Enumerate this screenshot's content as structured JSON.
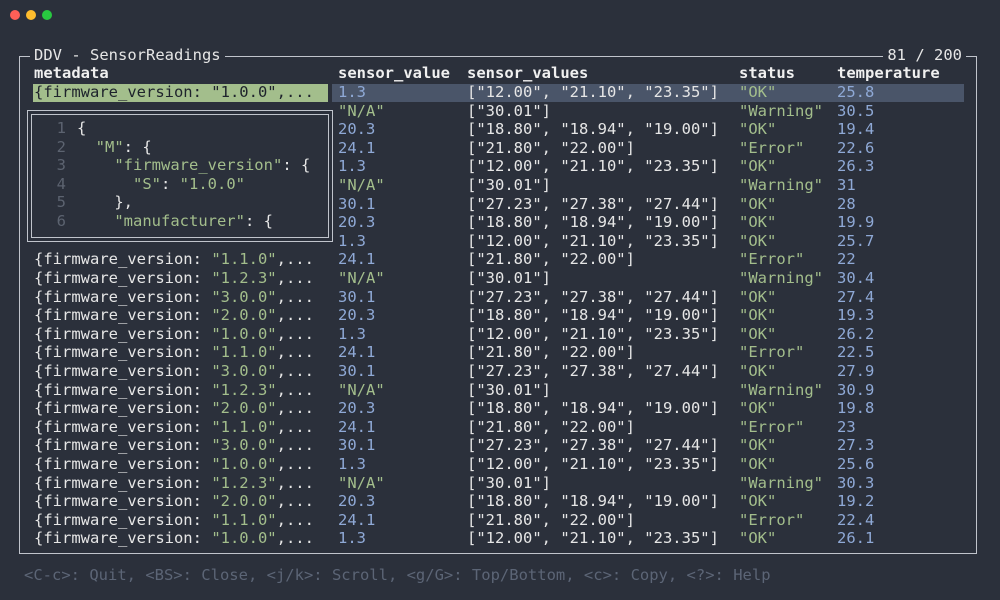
{
  "window": {
    "title": "DDV - SensorReadings",
    "position": "81 / 200"
  },
  "columns": [
    "metadata",
    "sensor_value",
    "sensor_values",
    "status",
    "temperature"
  ],
  "selected_row": {
    "metadata": "{firmware_version: \"1.0.0\",...",
    "sensor_value": "1.3",
    "sensor_values": "[\"12.00\", \"21.10\", \"23.35\"]",
    "status": "\"OK\"",
    "temperature": "25.8"
  },
  "rows": [
    {
      "metadata": "",
      "sensor_value": "\"N/A\"",
      "sensor_values": "[\"30.01\"]",
      "status": "\"Warning\"",
      "temperature": "30.5"
    },
    {
      "metadata": "",
      "sensor_value": "20.3",
      "sensor_values": "[\"18.80\", \"18.94\", \"19.00\"]",
      "status": "\"OK\"",
      "temperature": "19.4"
    },
    {
      "metadata": "",
      "sensor_value": "24.1",
      "sensor_values": "[\"21.80\", \"22.00\"]",
      "status": "\"Error\"",
      "temperature": "22.6"
    },
    {
      "metadata": "",
      "sensor_value": "1.3",
      "sensor_values": "[\"12.00\", \"21.10\", \"23.35\"]",
      "status": "\"OK\"",
      "temperature": "26.3"
    },
    {
      "metadata": "",
      "sensor_value": "\"N/A\"",
      "sensor_values": "[\"30.01\"]",
      "status": "\"Warning\"",
      "temperature": "31"
    },
    {
      "metadata": "",
      "sensor_value": "30.1",
      "sensor_values": "[\"27.23\", \"27.38\", \"27.44\"]",
      "status": "\"OK\"",
      "temperature": "28"
    },
    {
      "metadata": "",
      "sensor_value": "20.3",
      "sensor_values": "[\"18.80\", \"18.94\", \"19.00\"]",
      "status": "\"OK\"",
      "temperature": "19.9"
    },
    {
      "metadata": "",
      "sensor_value": "1.3",
      "sensor_values": "[\"12.00\", \"21.10\", \"23.35\"]",
      "status": "\"OK\"",
      "temperature": "25.7"
    },
    {
      "metadata": "{firmware_version: \"1.1.0\",...",
      "sensor_value": "24.1",
      "sensor_values": "[\"21.80\", \"22.00\"]",
      "status": "\"Error\"",
      "temperature": "22"
    },
    {
      "metadata": "{firmware_version: \"1.2.3\",...",
      "sensor_value": "\"N/A\"",
      "sensor_values": "[\"30.01\"]",
      "status": "\"Warning\"",
      "temperature": "30.4"
    },
    {
      "metadata": "{firmware_version: \"3.0.0\",...",
      "sensor_value": "30.1",
      "sensor_values": "[\"27.23\", \"27.38\", \"27.44\"]",
      "status": "\"OK\"",
      "temperature": "27.4"
    },
    {
      "metadata": "{firmware_version: \"2.0.0\",...",
      "sensor_value": "20.3",
      "sensor_values": "[\"18.80\", \"18.94\", \"19.00\"]",
      "status": "\"OK\"",
      "temperature": "19.3"
    },
    {
      "metadata": "{firmware_version: \"1.0.0\",...",
      "sensor_value": "1.3",
      "sensor_values": "[\"12.00\", \"21.10\", \"23.35\"]",
      "status": "\"OK\"",
      "temperature": "26.2"
    },
    {
      "metadata": "{firmware_version: \"1.1.0\",...",
      "sensor_value": "24.1",
      "sensor_values": "[\"21.80\", \"22.00\"]",
      "status": "\"Error\"",
      "temperature": "22.5"
    },
    {
      "metadata": "{firmware_version: \"3.0.0\",...",
      "sensor_value": "30.1",
      "sensor_values": "[\"27.23\", \"27.38\", \"27.44\"]",
      "status": "\"OK\"",
      "temperature": "27.9"
    },
    {
      "metadata": "{firmware_version: \"1.2.3\",...",
      "sensor_value": "\"N/A\"",
      "sensor_values": "[\"30.01\"]",
      "status": "\"Warning\"",
      "temperature": "30.9"
    },
    {
      "metadata": "{firmware_version: \"2.0.0\",...",
      "sensor_value": "20.3",
      "sensor_values": "[\"18.80\", \"18.94\", \"19.00\"]",
      "status": "\"OK\"",
      "temperature": "19.8"
    },
    {
      "metadata": "{firmware_version: \"1.1.0\",...",
      "sensor_value": "24.1",
      "sensor_values": "[\"21.80\", \"22.00\"]",
      "status": "\"Error\"",
      "temperature": "23"
    },
    {
      "metadata": "{firmware_version: \"3.0.0\",...",
      "sensor_value": "30.1",
      "sensor_values": "[\"27.23\", \"27.38\", \"27.44\"]",
      "status": "\"OK\"",
      "temperature": "27.3"
    },
    {
      "metadata": "{firmware_version: \"1.0.0\",...",
      "sensor_value": "1.3",
      "sensor_values": "[\"12.00\", \"21.10\", \"23.35\"]",
      "status": "\"OK\"",
      "temperature": "25.6"
    },
    {
      "metadata": "{firmware_version: \"1.2.3\",...",
      "sensor_value": "\"N/A\"",
      "sensor_values": "[\"30.01\"]",
      "status": "\"Warning\"",
      "temperature": "30.3"
    },
    {
      "metadata": "{firmware_version: \"2.0.0\",...",
      "sensor_value": "20.3",
      "sensor_values": "[\"18.80\", \"18.94\", \"19.00\"]",
      "status": "\"OK\"",
      "temperature": "19.2"
    },
    {
      "metadata": "{firmware_version: \"1.1.0\",...",
      "sensor_value": "24.1",
      "sensor_values": "[\"21.80\", \"22.00\"]",
      "status": "\"Error\"",
      "temperature": "22.4"
    },
    {
      "metadata": "{firmware_version: \"1.0.0\",...",
      "sensor_value": "1.3",
      "sensor_values": "[\"12.00\", \"21.10\", \"23.35\"]",
      "status": "\"OK\"",
      "temperature": "26.1"
    }
  ],
  "popup": {
    "lines": [
      {
        "num": "1",
        "parts": [
          {
            "t": "{",
            "k": false
          }
        ]
      },
      {
        "num": "2",
        "parts": [
          {
            "t": "  ",
            "k": false
          },
          {
            "t": "\"M\"",
            "k": true
          },
          {
            "t": ": {",
            "k": false
          }
        ]
      },
      {
        "num": "3",
        "parts": [
          {
            "t": "    ",
            "k": false
          },
          {
            "t": "\"firmware_version\"",
            "k": true
          },
          {
            "t": ": {",
            "k": false
          }
        ]
      },
      {
        "num": "4",
        "parts": [
          {
            "t": "      ",
            "k": false
          },
          {
            "t": "\"S\"",
            "k": true
          },
          {
            "t": ": ",
            "k": false
          },
          {
            "t": "\"1.0.0\"",
            "k": true
          }
        ]
      },
      {
        "num": "5",
        "parts": [
          {
            "t": "    },",
            "k": false
          }
        ]
      },
      {
        "num": "6",
        "parts": [
          {
            "t": "    ",
            "k": false
          },
          {
            "t": "\"manufacturer\"",
            "k": true
          },
          {
            "t": ": {",
            "k": false
          }
        ]
      }
    ]
  },
  "footer": {
    "help_text": "<C-c>: Quit, <BS>: Close, <j/k>: Scroll, <g/G>: Top/Bottom, <c>: Copy, <?>: Help"
  }
}
